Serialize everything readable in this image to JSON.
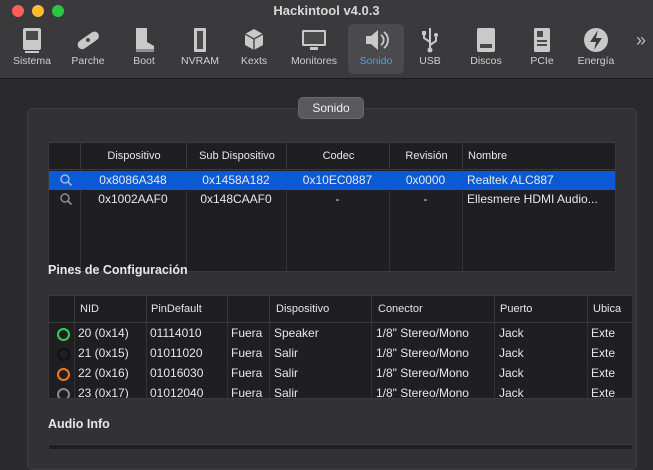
{
  "window": {
    "title": "Hackintool v4.0.3"
  },
  "toolbar": {
    "items": [
      {
        "label": "Sistema",
        "icon": "computer-icon"
      },
      {
        "label": "Parche",
        "icon": "bandage-icon"
      },
      {
        "label": "Boot",
        "icon": "boot-icon"
      },
      {
        "label": "NVRAM",
        "icon": "memory-icon"
      },
      {
        "label": "Kexts",
        "icon": "cubes-icon"
      },
      {
        "label": "Monitores",
        "icon": "monitor-icon"
      },
      {
        "label": "Sonido",
        "icon": "speaker-icon",
        "active": true
      },
      {
        "label": "USB",
        "icon": "usb-icon"
      },
      {
        "label": "Discos",
        "icon": "disk-icon"
      },
      {
        "label": "PCIe",
        "icon": "pcie-icon"
      },
      {
        "label": "Energía",
        "icon": "power-icon"
      }
    ],
    "more": "»"
  },
  "section_tab": {
    "label": "Sonido"
  },
  "devices_table": {
    "columns": [
      "Dispositivo",
      "Sub Dispositivo",
      "Codec",
      "Revisión",
      "Nombre"
    ],
    "rows": [
      {
        "dispositivo": "0x8086A348",
        "sub": "0x1458A182",
        "codec": "0x10EC0887",
        "rev": "0x0000",
        "nombre": "Realtek ALC887",
        "selected": true
      },
      {
        "dispositivo": "0x1002AAF0",
        "sub": "0x148CAAF0",
        "codec": "-",
        "rev": "-",
        "nombre": "Ellesmere HDMI Audio..."
      }
    ]
  },
  "pins_section": {
    "title": "Pines de Configuración"
  },
  "pins_table": {
    "columns": [
      "NID",
      "PinDefault",
      "",
      "Dispositivo",
      "Conector",
      "Puerto",
      "Ubica"
    ],
    "rows": [
      {
        "nid": "20 (0x14)",
        "pindefault": "01114010",
        "loc": "Fuera",
        "dispositivo": "Speaker",
        "conector": "1/8\" Stereo/Mono",
        "puerto": "Jack",
        "ubica": "Exte",
        "color": "#33d04a"
      },
      {
        "nid": "21 (0x15)",
        "pindefault": "01011020",
        "loc": "Fuera",
        "dispositivo": "Salir",
        "conector": "1/8\" Stereo/Mono",
        "puerto": "Jack",
        "ubica": "Exte",
        "color": "#111111"
      },
      {
        "nid": "22 (0x16)",
        "pindefault": "01016030",
        "loc": "Fuera",
        "dispositivo": "Salir",
        "conector": "1/8\" Stereo/Mono",
        "puerto": "Jack",
        "ubica": "Exte",
        "color": "#f07a22"
      },
      {
        "nid": "23 (0x17)",
        "pindefault": "01012040",
        "loc": "Fuera",
        "dispositivo": "Salir",
        "conector": "1/8\" Stereo/Mono",
        "puerto": "Jack",
        "ubica": "Exte",
        "color": "#8a8a8a"
      }
    ]
  },
  "audio_section": {
    "title": "Audio Info"
  }
}
